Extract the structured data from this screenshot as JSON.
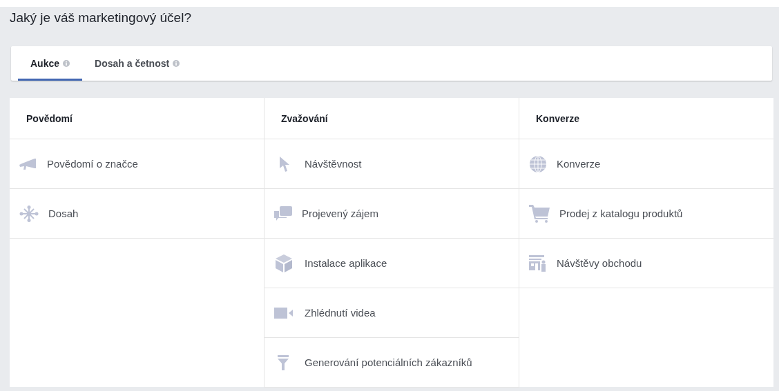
{
  "title": "Jaký je váš marketingový účel?",
  "tabs": [
    {
      "label": "Aukce",
      "selected": true
    },
    {
      "label": "Dosah a četnost",
      "selected": false
    }
  ],
  "columns": [
    {
      "heading": "Povědomí",
      "items": [
        {
          "kind": "megaphone",
          "label": "Povědomí o značce"
        },
        {
          "kind": "network",
          "label": "Dosah"
        }
      ]
    },
    {
      "heading": "Zvažování",
      "items": [
        {
          "kind": "cursor",
          "label": "Návštěvnost"
        },
        {
          "kind": "chat",
          "label": "Projevený zájem"
        },
        {
          "kind": "cube",
          "label": "Instalace aplikace"
        },
        {
          "kind": "video",
          "label": "Zhlédnutí videa"
        },
        {
          "kind": "funnel",
          "label": "Generování potenciálních zákazníků"
        }
      ]
    },
    {
      "heading": "Konverze",
      "items": [
        {
          "kind": "globe",
          "label": "Konverze"
        },
        {
          "kind": "cart",
          "label": "Prodej z katalogu produktů"
        },
        {
          "kind": "store",
          "label": "Návštěvy obchodu"
        }
      ]
    }
  ]
}
